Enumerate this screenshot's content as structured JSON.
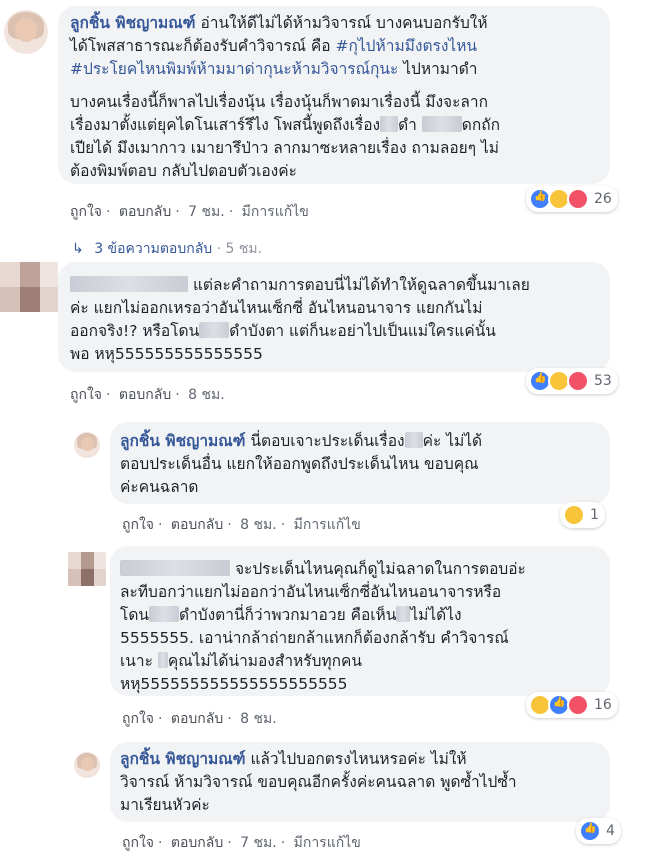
{
  "comments": [
    {
      "author": "ลูกชิ้น พิชญามณฑ์",
      "lines": [
        {
          "text": " อ่านให้ดีไม่ได้ห้ามวิจารณ์ บางคนบอกรับให้"
        },
        {
          "text": "ได้โพสสาธารณะก็ต้องรับคำวิจารณ์ คือ ",
          "tag": "#กุไปห้ามมึงตรงไหน"
        },
        {
          "tag": "#ประโยคไหนพิมพ์ห้ามมาด่ากุนะห้ามวิจารณ์กุนะ",
          "text": " ไปหามาดำ"
        },
        {
          "text": ""
        },
        {
          "text": "บางคนเรื่องนี้ก็พาลไปเรื่องนุ้น เรื่องนุ้นก็พาดมาเรื่องนี้ มึงจะลาก"
        },
        {
          "text": "เรื่องมาตั้งแต่ยุคไดโนเสาร์รึไง โพสนี้พูดถึงเรื่อง",
          "blur": 18,
          "text2": "ดำ ",
          "blur2": 40,
          "text3": "ดกถัก"
        },
        {
          "text": "เปียได้ มึงเมากาว เมายารึป่าว ลากมาซะหลายเรื่อง ถามลอยๆ ไม่"
        },
        {
          "text": "ต้องพิมพ์ตอบ กลับไปตอบตัวเองค่ะ"
        }
      ],
      "actions": {
        "like": "ถูกใจ",
        "reply": "ตอบกลับ",
        "time": "7 ชม.",
        "edited": "มีการแก้ไข"
      },
      "reaction_count": "26"
    },
    {
      "author_blurred": true,
      "lines": [
        {
          "text": "แต่ละคำถามการตอบนี่ไม่ได้ทำให้ดูฉลาดขึ้นมาเลย"
        },
        {
          "text": "ค่ะ แยกไม่ออกเหรอว่าอันไหนเซ็กซี่ อันไหนอนาจาร แยกกันไม่"
        },
        {
          "text": "ออกจริง!? หรือโดน",
          "blur": 30,
          "text2": "ดำบังตา แต่ก็นะอย่าไปเป็นแม่ใครแค่นั้น"
        },
        {
          "text": "พอ หหุ555555555555555"
        }
      ],
      "actions": {
        "like": "ถูกใจ",
        "reply": "ตอบกลับ",
        "time": "8 ชม."
      },
      "reaction_count": "53"
    },
    {
      "author": "ลูกชิ้น พิชญามณฑ์",
      "lines": [
        {
          "text": " นี่ตอบเจาะประเด็นเรื่อง",
          "blur": 18,
          "text2": "ค่ะ ไม่ได้"
        },
        {
          "text": "ตอบประเด็นอื่น แยกให้ออกพูดถึงประเด็นไหน ขอบคุณ"
        },
        {
          "text": "ค่ะคนฉลาด"
        }
      ],
      "actions": {
        "like": "ถูกใจ",
        "reply": "ตอบกลับ",
        "time": "8 ชม.",
        "edited": "มีการแก้ไข"
      },
      "reaction_count": "1"
    },
    {
      "author_blurred": true,
      "lines": [
        {
          "text": "จะประเด็นไหนคุณก็ดูไม่ฉลาดในการตอบอ่ะ"
        },
        {
          "text": "ละทีบอกว่าแยกไม่ออกว่าอันไหนเซ็กซี่อันไหนอนาจารหรือ"
        },
        {
          "text": "โดน",
          "blur": 30,
          "text2": "ดำบังตานี่ก็ว่าพวกมาอวย คือเห็น",
          "blur2": 14,
          "text3": "ไม่ได้ไง"
        },
        {
          "text": "5555555. เอาน่ากล้าถ่ายกล้าแหกก็ต้องกล้ารับ คำวิจารณ์"
        },
        {
          "text": "เนาะ ",
          "blur": 10,
          "text2": "คุณไม่ได้น่ามองสำหรับทุกคน"
        },
        {
          "text": "หหุ555555555555555555555"
        }
      ],
      "actions": {
        "like": "ถูกใจ",
        "reply": "ตอบกลับ",
        "time": "8 ชม."
      },
      "reaction_count": "16"
    },
    {
      "author": "ลูกชิ้น พิชญามณฑ์",
      "lines": [
        {
          "text": " แล้วไปบอกตรงไหนหรอค่ะ ไม่ให้"
        },
        {
          "text": "วิจารณ์ ห้ามวิจารณ์ ขอบคุณอีกครั้งค่ะคนฉลาด พูดซ้ำไปซ้ำ"
        },
        {
          "text": "มาเรียนหัวค่ะ"
        }
      ],
      "actions": {
        "like": "ถูกใจ",
        "reply": "ตอบกลับ",
        "time": "7 ชม.",
        "edited": "มีการแก้ไข"
      },
      "reaction_count": "4"
    }
  ],
  "replies_link": {
    "arrow": "↳",
    "label": "3 ข้อความตอบกลับ",
    "time": "5 ชม."
  },
  "colors": {
    "link": "#365899",
    "bubble": "#f2f3f5",
    "meta": "#606770"
  }
}
